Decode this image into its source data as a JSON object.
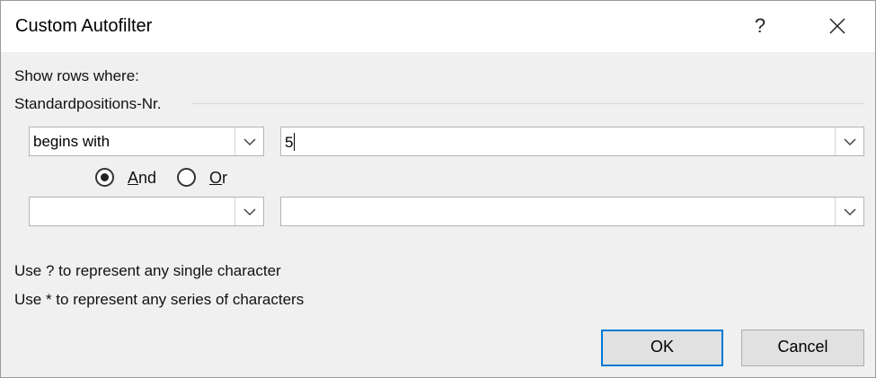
{
  "window": {
    "title": "Custom Autofilter",
    "help_glyph": "?",
    "close_icon": "close-icon"
  },
  "filter": {
    "show_rows_label": "Show rows where:",
    "field_name": "Standardpositions-Nr.",
    "condition1": {
      "operator": "begins with",
      "value": "5"
    },
    "logic": {
      "and_label": "And",
      "and_accel": "A",
      "and_rest": "nd",
      "or_label": "Or",
      "or_accel": "O",
      "or_rest": "r",
      "selected": "And"
    },
    "condition2": {
      "operator": "",
      "value": ""
    }
  },
  "hints": {
    "line1": "Use ? to represent any single character",
    "line2": "Use * to represent any series of characters"
  },
  "buttons": {
    "ok": "OK",
    "cancel": "Cancel"
  },
  "colors": {
    "accent": "#0078d7",
    "dialog_bg": "#f0f0f0"
  }
}
